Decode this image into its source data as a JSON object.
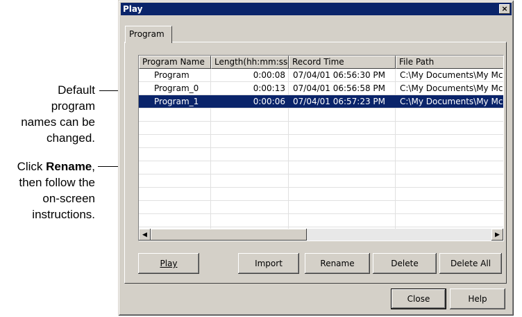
{
  "annotations": {
    "callout1": [
      "Default",
      "program",
      "names can be",
      "changed."
    ],
    "callout2_line1_prefix": "Click ",
    "callout2_line1_bold": "Rename",
    "callout2_line1_suffix": ",",
    "callout2_rest": [
      "then follow the",
      "on-screen",
      "instructions."
    ]
  },
  "window": {
    "title": "Play",
    "close_glyph": "×",
    "tab_label": "Program"
  },
  "table": {
    "columns": [
      "Program Name",
      "Length(hh:mm:ss)",
      "Record Time",
      "File Path"
    ],
    "rows": [
      {
        "name": "Program",
        "length": "0:00:08",
        "record_time": "07/04/01 06:56:30 PM",
        "path": "C:\\My Documents\\My Mc",
        "selected": false
      },
      {
        "name": "Program_0",
        "length": "0:00:13",
        "record_time": "07/04/01 06:56:58 PM",
        "path": "C:\\My Documents\\My Mc",
        "selected": false
      },
      {
        "name": "Program_1",
        "length": "0:00:06",
        "record_time": "07/04/01 06:57:23 PM",
        "path": "C:\\My Documents\\My Mc",
        "selected": true
      }
    ]
  },
  "scroll": {
    "left_glyph": "◀",
    "right_glyph": "▶"
  },
  "buttons": {
    "play": "Play",
    "import": "Import",
    "rename": "Rename",
    "delete": "Delete",
    "delete_all": "Delete All",
    "close": "Close",
    "help": "Help"
  },
  "colors": {
    "selection": "#0a246a",
    "titlebar": "#0a246a",
    "face": "#d4d0c8"
  }
}
